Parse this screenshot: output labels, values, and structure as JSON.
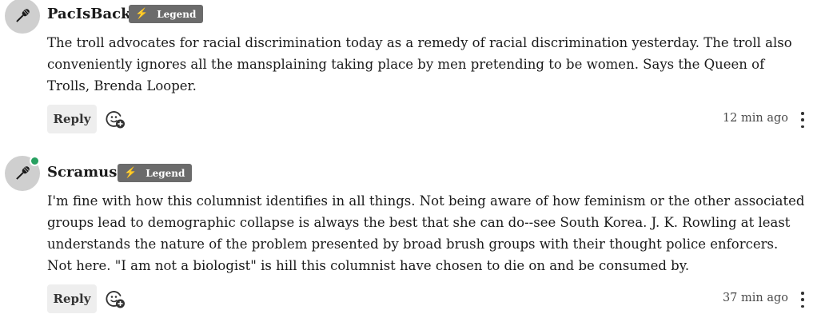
{
  "comments": [
    {
      "username": "PacIsBack",
      "badge": {
        "icon": "lightning-bolt-icon",
        "label": "Legend"
      },
      "avatar_icon": "microphone-icon",
      "online": false,
      "text": "The troll advocates for racial discrimination today as a remedy of racial discrimination yesterday. The troll also conveniently ignores all the mansplaining taking place by men pretending to be women. Says the Queen of Trolls, Brenda Looper.",
      "reply_label": "Reply",
      "timestamp": "12 min ago"
    },
    {
      "username": "Scramus",
      "badge": {
        "icon": "lightning-bolt-icon",
        "label": "Legend"
      },
      "avatar_icon": "microphone-icon",
      "online": true,
      "text": "I'm fine with how this columnist identifies in all things. Not being aware of how feminism or the other associated groups lead to demographic collapse is always the best that she can do--see South Korea. J. K. Rowling at least understands the nature of the problem presented by broad brush groups with their thought police enforcers. Not here. \"I am not a biologist\" is hill this columnist have chosen to die on and be consumed by.",
      "reply_label": "Reply",
      "timestamp": "37 min ago"
    }
  ],
  "colors": {
    "badge_bg": "#6b6b6b",
    "badge_bolt": "#f5c518",
    "online_dot": "#27a060",
    "avatar_bg": "#cfcfcf",
    "reply_bg": "#eeeeee"
  }
}
